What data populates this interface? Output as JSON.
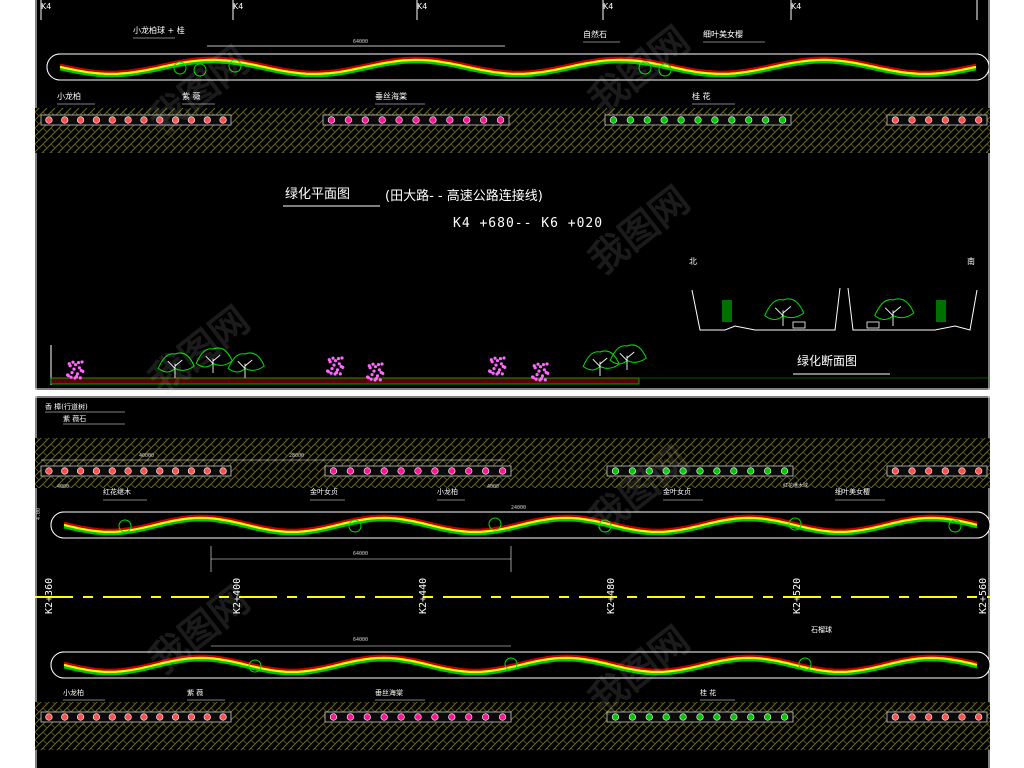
{
  "colors": {
    "background": "#000000",
    "frame": "#ffffff",
    "shrub_green": "#00c800",
    "flower_magenta": "#ff1493",
    "stripe_red": "#c80000",
    "stripe_yellow": "#ffff00",
    "hatch_olive": "#6b6b22",
    "centerline_yellow": "#ffff00"
  },
  "top_panel": {
    "chainage_marks": [
      "K4",
      "K4",
      "K4",
      "K4",
      "K4"
    ],
    "median_labels": {
      "left": "小龙柏球 + 桂",
      "stone": "自然石",
      "right": "细叶美女樱"
    },
    "dimension_main": "64000",
    "verge_labels": [
      "小龙柏",
      "紫 薇",
      "垂丝海棠",
      "桂 花"
    ],
    "plan_title": "绿化平面图",
    "plan_subtitle": "(田大路- - 高速公路连接线)",
    "stake_range": "K4 +680-- K6 +020",
    "section_title": "绿化断面图",
    "section_left": "北",
    "section_right": "南"
  },
  "bottom_panel": {
    "top_labels": [
      "香 樟(行道树)",
      "紫 薇石"
    ],
    "dims_top": [
      "40000",
      "28000",
      "4000",
      "4000"
    ],
    "median_labels": [
      "红花继木",
      "金叶女贞",
      "小龙柏",
      "金叶女贞",
      "细叶美女樱"
    ],
    "median_mid_label": "红花继木球",
    "dim_median": "64000",
    "dim_median2": "24000",
    "dim_median3": "64000",
    "side_dim": "4.00",
    "chainages": [
      "K2+360",
      "K2+400",
      "K2+440",
      "K2+480",
      "K2+520",
      "K2+560"
    ],
    "lower_median_label": "石榴球",
    "verge_labels": [
      "小龙柏",
      "紫 薇",
      "垂丝海棠",
      "桂 花"
    ]
  },
  "watermark": "我图网"
}
